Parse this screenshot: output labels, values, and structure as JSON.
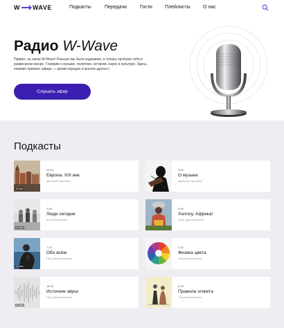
{
  "header": {
    "logo": {
      "left": "W",
      "right": "WAVE"
    },
    "nav": [
      "Подкасты",
      "Передачи",
      "Гости",
      "Плейлисты",
      "О нас"
    ]
  },
  "hero": {
    "title": "Радио",
    "title_italic": "W-Wave",
    "description": "Привет, на связи W-Wave! Раньше мы были изданием, а теперь пробуем себя в развесрном жанре. Говорим о музыке, политике, истории, науке и культуре. Здесь, помимо прямого эфира — архив передач и многое другое:)",
    "listen_button": "Слушать эфир"
  },
  "podcasts": {
    "heading": "Подкасты",
    "items": [
      {
        "date": "15.03",
        "title": "Европа. XIX век",
        "author": "Дмитрий Гупанберг",
        "duration": "26 мин"
      },
      {
        "date": "5.02",
        "title": "О музыке",
        "author": "Дмитрий Гупанберг",
        "duration": ""
      },
      {
        "date": "0.54",
        "title": "Люди сегодня",
        "author": "Анна Васильева",
        "duration": "24 мин"
      },
      {
        "date": "9.04",
        "title": "Хэллоу, Африка!",
        "author": "Пётр Дмитриевский",
        "duration": ""
      },
      {
        "date": "7.03",
        "title": "Обо всём",
        "author": "Пётр Дмитриевский",
        "duration": "24 мин"
      },
      {
        "date": "9.15",
        "title": "Физика цвета",
        "author": "Татьяна Флетнева",
        "duration": ""
      },
      {
        "date": "16.04",
        "title": "Источник звука",
        "author": "Пётр Дмитриевский",
        "duration": "21 мин"
      },
      {
        "date": "6.03",
        "title": "Правила этикета",
        "author": "Татьяна Флетнева",
        "duration": ""
      }
    ]
  },
  "colors": {
    "accent": "#3c1fb2",
    "section_bg": "#eeeef2"
  }
}
